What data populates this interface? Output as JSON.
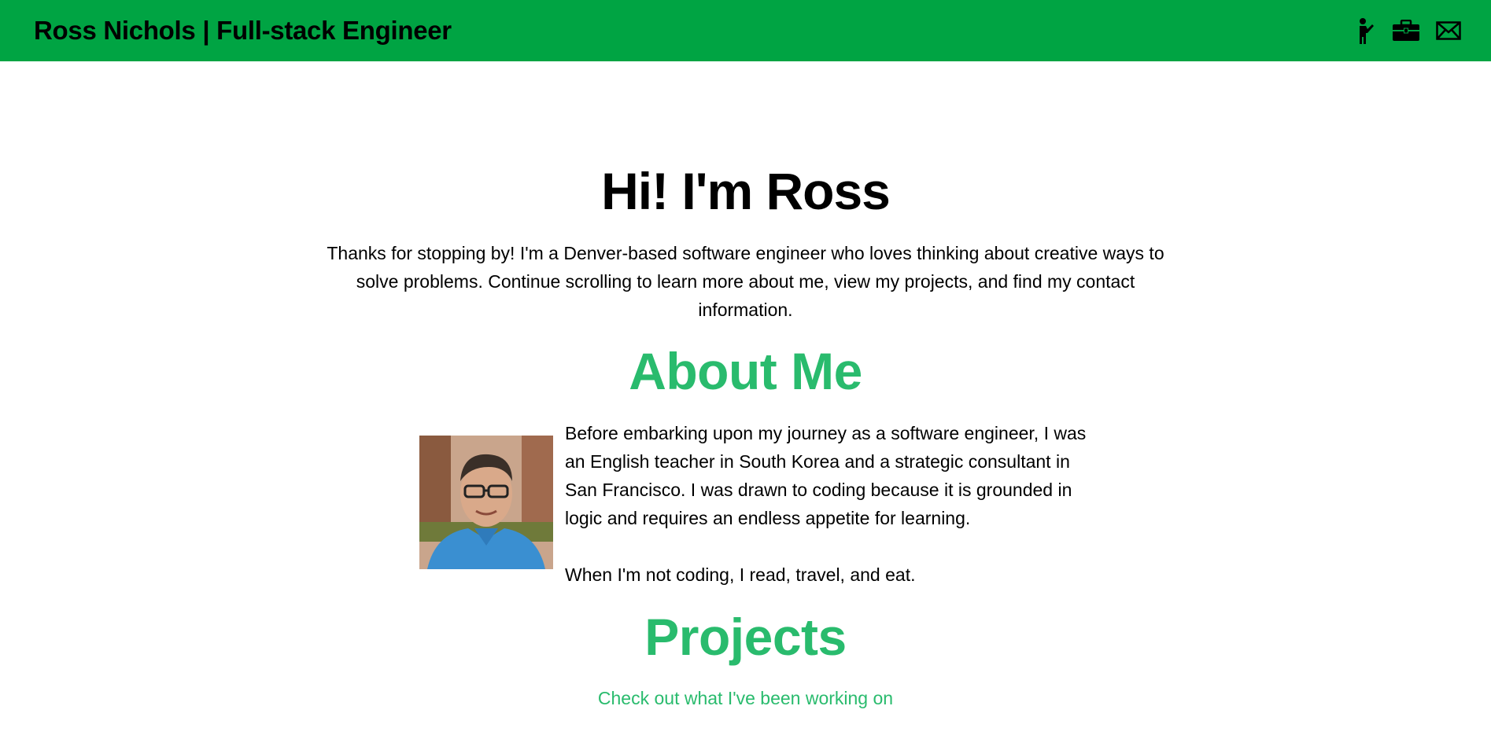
{
  "header": {
    "brand": "Ross Nichols | Full-stack Engineer",
    "icons": [
      "presenter-icon",
      "briefcase-icon",
      "envelope-icon"
    ]
  },
  "hero": {
    "title": "Hi! I'm Ross",
    "text": "Thanks for stopping by! I'm a Denver-based software engineer who loves thinking about creative ways to solve problems. Continue scrolling to learn more about me, view my projects, and find my contact information."
  },
  "about": {
    "title": "About Me",
    "paragraph1": "Before embarking upon my journey as a software engineer, I was an English teacher in South Korea and a strategic consultant in San Francisco. I was drawn to coding because it is grounded in logic and requires an endless appetite for learning.",
    "paragraph2": "When I'm not coding, I read, travel, and eat."
  },
  "projects": {
    "title": "Projects",
    "subtitle": "Check out what I've been working on"
  },
  "colors": {
    "navbar": "#00a443",
    "accent": "#29bb6d"
  }
}
